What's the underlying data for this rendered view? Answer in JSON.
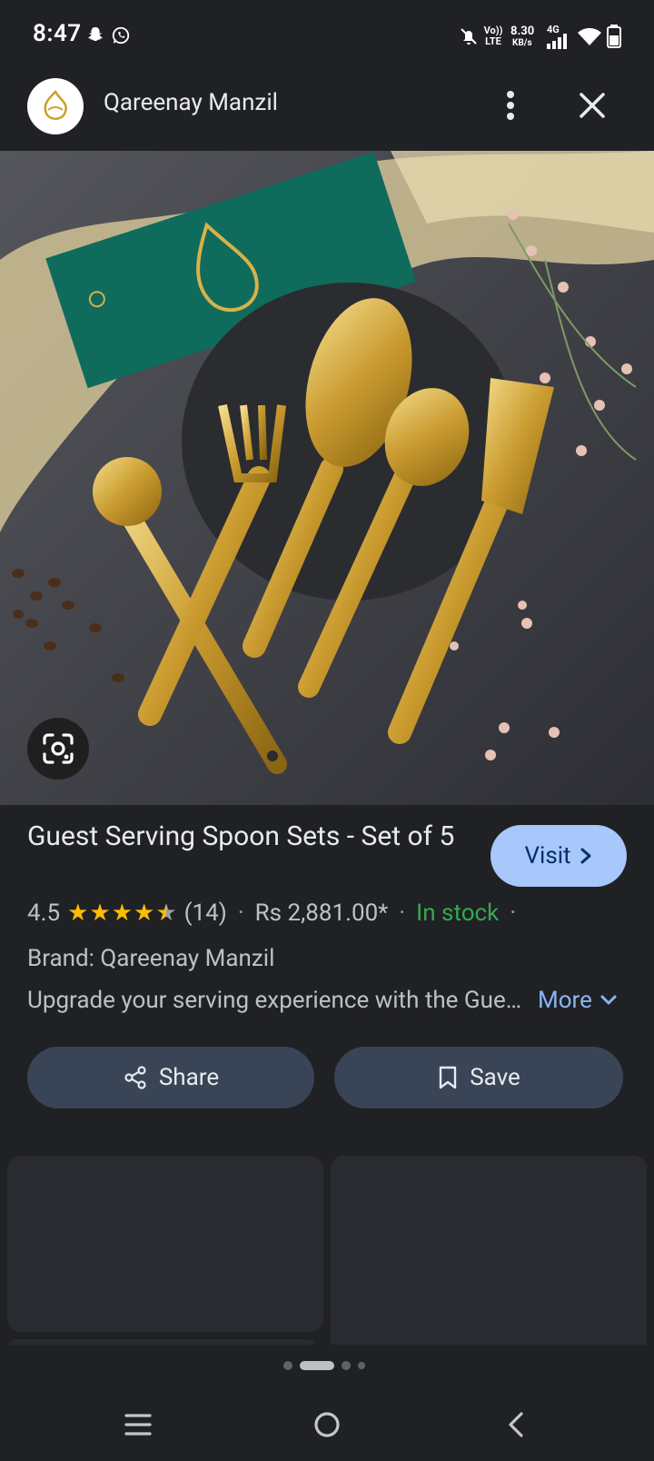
{
  "status_bar": {
    "time": "8:47",
    "network_speed": "8.30",
    "network_speed_unit": "KB/s",
    "volte": "Vo)) LTE",
    "network_type": "4G"
  },
  "header": {
    "site_name": "Qareenay Manzil"
  },
  "product": {
    "title": "Guest Serving Spoon Sets - Set of 5",
    "visit_label": "Visit",
    "rating": "4.5",
    "stars": 4.5,
    "review_count": "(14)",
    "price": "Rs 2,881.00*",
    "stock": "In stock",
    "brand": "Brand: Qareenay Manzil",
    "description": "Upgrade your serving experience with the Guest Serving Spoon Sets",
    "more_label": "More"
  },
  "actions": {
    "share_label": "Share",
    "save_label": "Save"
  },
  "pager": {
    "count": 4,
    "active_index": 1
  },
  "colors": {
    "background": "#202124",
    "accent": "#a8c7fa",
    "link": "#8ab4f8",
    "in_stock": "#34a853",
    "star": "#fbbc04",
    "pill": "#394457"
  }
}
